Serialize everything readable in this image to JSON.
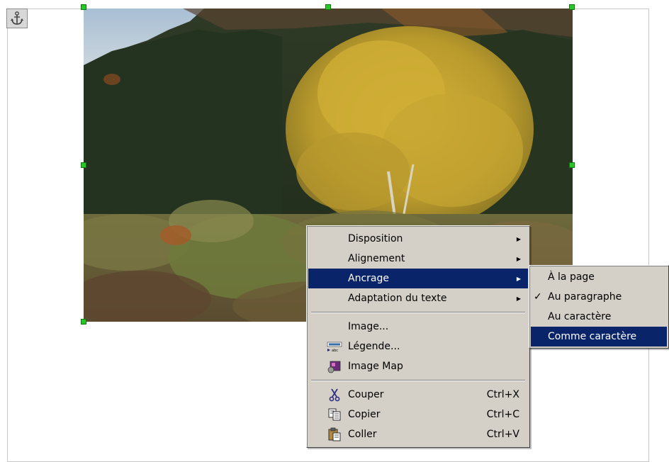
{
  "context_menu": {
    "items": [
      {
        "label": "Disposition",
        "submenu": true
      },
      {
        "label": "Alignement",
        "submenu": true
      },
      {
        "label": "Ancrage",
        "submenu": true,
        "highlighted": true
      },
      {
        "label": "Adaptation du texte",
        "submenu": true
      },
      {
        "label": "Image..."
      },
      {
        "label": "Légende...",
        "icon": "caption-icon"
      },
      {
        "label": "Image Map",
        "icon": "image-map-icon"
      },
      {
        "label": "Couper",
        "shortcut": "Ctrl+X",
        "icon": "scissors-icon"
      },
      {
        "label": "Copier",
        "shortcut": "Ctrl+C",
        "icon": "copy-icon"
      },
      {
        "label": "Coller",
        "shortcut": "Ctrl+V",
        "icon": "paste-icon"
      }
    ]
  },
  "anchor_submenu": {
    "items": [
      {
        "label": "À la page"
      },
      {
        "label": "Au paragraphe",
        "checked": true
      },
      {
        "label": "Au caractère"
      },
      {
        "label": "Comme caractère",
        "highlighted": true
      }
    ],
    "check_mark": "✓"
  },
  "image": {
    "subject": "autumn forest with yellow tree"
  },
  "icons": {
    "anchor": "anchor-icon",
    "submenu_arrow": "▶"
  },
  "colors": {
    "highlight": "#0a246a",
    "menu_bg": "#d4d0c8",
    "handle": "#26c826"
  }
}
